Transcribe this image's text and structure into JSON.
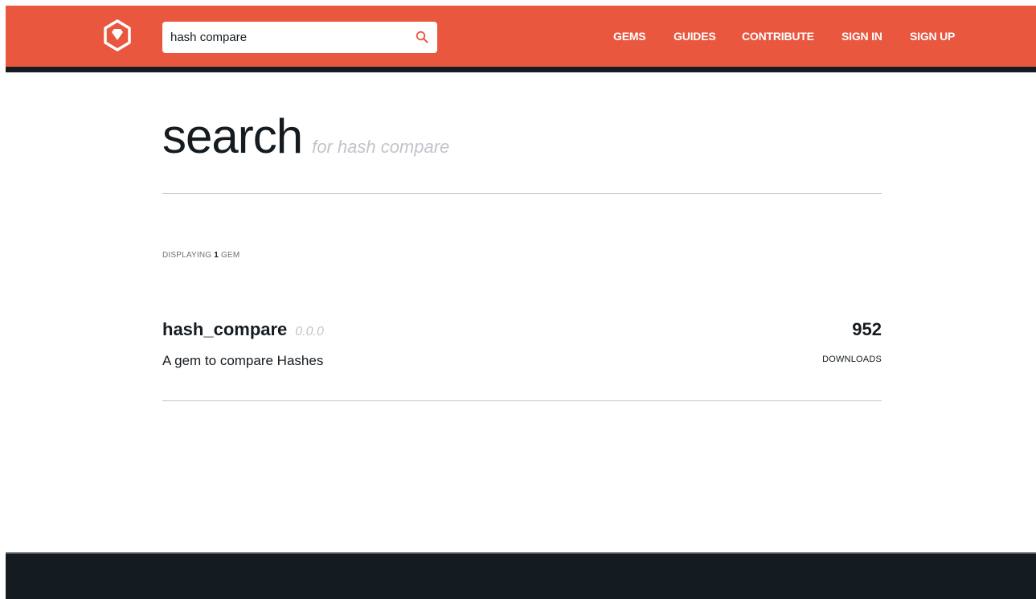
{
  "header": {
    "search": {
      "value": "hash compare",
      "placeholder": ""
    },
    "nav": [
      {
        "label": "GEMS"
      },
      {
        "label": "GUIDES"
      },
      {
        "label": "CONTRIBUTE"
      },
      {
        "label": "SIGN IN"
      },
      {
        "label": "SIGN UP"
      }
    ]
  },
  "main": {
    "title": "search",
    "subtitle": "for hash compare",
    "count": {
      "prefix": "DISPLAYING",
      "number": "1",
      "suffix": "GEM"
    },
    "results": [
      {
        "name": "hash_compare",
        "version": "0.0.0",
        "description": "A gem to compare Hashes",
        "downloads": "952",
        "downloads_label": "DOWNLOADS"
      }
    ]
  },
  "colors": {
    "brand": "#e9573f",
    "dark": "#141c22",
    "muted": "#c1c4ca"
  },
  "icons": {
    "logo": "rubygems-logo-icon",
    "search": "search-icon"
  }
}
